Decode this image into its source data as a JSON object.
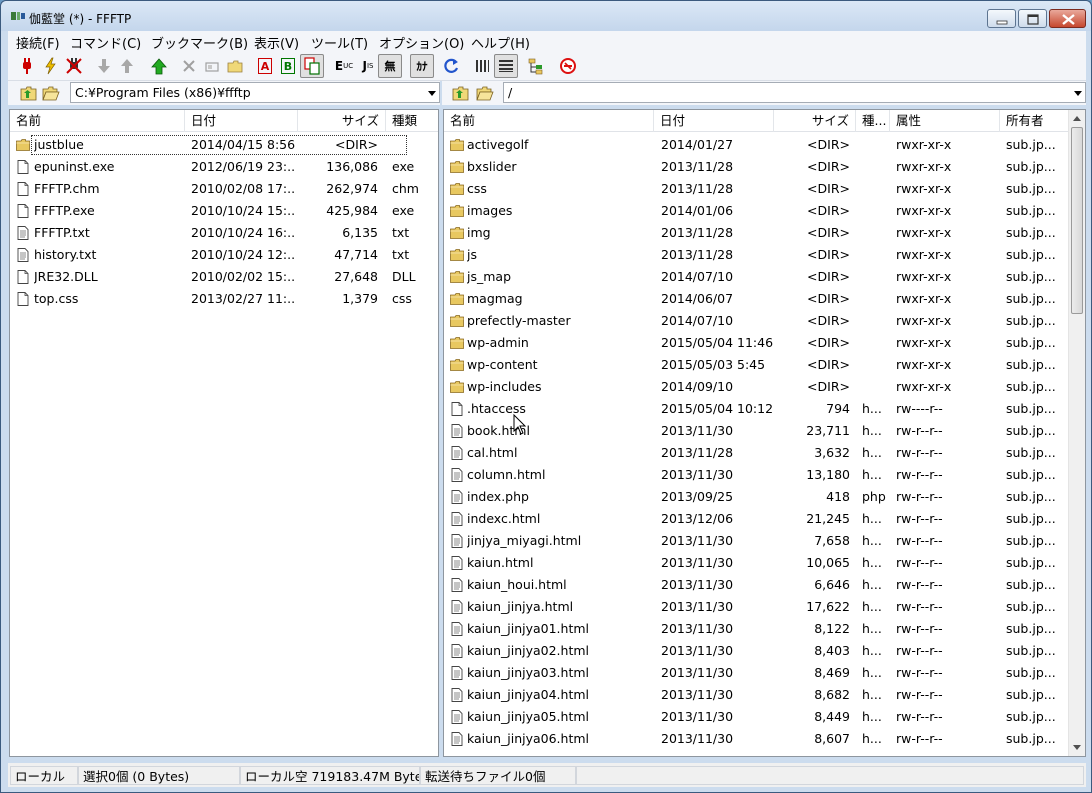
{
  "window": {
    "title": "伽藍堂 (*) - FFFTP"
  },
  "menu": [
    "接続(F)",
    "コマンド(C)",
    "ブックマーク(B)",
    "表示(V)",
    "ツール(T)",
    "オプション(O)",
    "ヘルプ(H)"
  ],
  "toolbar": {
    "ascii_mode": "A",
    "binary_mode": "B",
    "euc_label": "E",
    "jis_label": "J",
    "no_convert_label": "無",
    "kana_label": "ｶﾅ"
  },
  "local": {
    "path": "C:¥Program Files (x86)¥ffftp",
    "columns": {
      "name": "名前",
      "date": "日付",
      "size": "サイズ",
      "type": "種類"
    },
    "files": [
      {
        "name": "justblue",
        "date": "2014/04/15  8:56",
        "size": "<DIR>",
        "type": "",
        "icon": "folder-icon"
      },
      {
        "name": "epuninst.exe",
        "date": "2012/06/19 23:...",
        "size": "136,086",
        "type": "exe",
        "icon": "file-icon"
      },
      {
        "name": "FFFTP.chm",
        "date": "2010/02/08 17:...",
        "size": "262,974",
        "type": "chm",
        "icon": "file-icon"
      },
      {
        "name": "FFFTP.exe",
        "date": "2010/10/24 15:...",
        "size": "425,984",
        "type": "exe",
        "icon": "file-icon"
      },
      {
        "name": "FFFTP.txt",
        "date": "2010/10/24 16:...",
        "size": "6,135",
        "type": "txt",
        "icon": "text-file-icon"
      },
      {
        "name": "history.txt",
        "date": "2010/10/24 12:...",
        "size": "47,714",
        "type": "txt",
        "icon": "text-file-icon"
      },
      {
        "name": "JRE32.DLL",
        "date": "2010/02/02 15:...",
        "size": "27,648",
        "type": "DLL",
        "icon": "file-icon"
      },
      {
        "name": "top.css",
        "date": "2013/02/27 11:...",
        "size": "1,379",
        "type": "css",
        "icon": "file-icon"
      }
    ]
  },
  "remote": {
    "path": "/",
    "columns": {
      "name": "名前",
      "date": "日付",
      "size": "サイズ",
      "type": "種...",
      "attr": "属性",
      "owner": "所有者"
    },
    "files": [
      {
        "name": "activegolf",
        "date": "2014/01/27",
        "size": "<DIR>",
        "type": "",
        "attr": "rwxr-xr-x",
        "owner": "sub.jp...",
        "icon": "folder-icon"
      },
      {
        "name": "bxslider",
        "date": "2013/11/28",
        "size": "<DIR>",
        "type": "",
        "attr": "rwxr-xr-x",
        "owner": "sub.jp...",
        "icon": "folder-icon"
      },
      {
        "name": "css",
        "date": "2013/11/28",
        "size": "<DIR>",
        "type": "",
        "attr": "rwxr-xr-x",
        "owner": "sub.jp...",
        "icon": "folder-icon"
      },
      {
        "name": "images",
        "date": "2014/01/06",
        "size": "<DIR>",
        "type": "",
        "attr": "rwxr-xr-x",
        "owner": "sub.jp...",
        "icon": "folder-icon"
      },
      {
        "name": "img",
        "date": "2013/11/28",
        "size": "<DIR>",
        "type": "",
        "attr": "rwxr-xr-x",
        "owner": "sub.jp...",
        "icon": "folder-icon"
      },
      {
        "name": "js",
        "date": "2013/11/28",
        "size": "<DIR>",
        "type": "",
        "attr": "rwxr-xr-x",
        "owner": "sub.jp...",
        "icon": "folder-icon"
      },
      {
        "name": "js_map",
        "date": "2014/07/10",
        "size": "<DIR>",
        "type": "",
        "attr": "rwxr-xr-x",
        "owner": "sub.jp...",
        "icon": "folder-icon"
      },
      {
        "name": "magmag",
        "date": "2014/06/07",
        "size": "<DIR>",
        "type": "",
        "attr": "rwxr-xr-x",
        "owner": "sub.jp...",
        "icon": "folder-icon"
      },
      {
        "name": "prefectly-master",
        "date": "2014/07/10",
        "size": "<DIR>",
        "type": "",
        "attr": "rwxr-xr-x",
        "owner": "sub.jp...",
        "icon": "folder-icon"
      },
      {
        "name": "wp-admin",
        "date": "2015/05/04 11:46",
        "size": "<DIR>",
        "type": "",
        "attr": "rwxr-xr-x",
        "owner": "sub.jp...",
        "icon": "folder-icon"
      },
      {
        "name": "wp-content",
        "date": "2015/05/03  5:45",
        "size": "<DIR>",
        "type": "",
        "attr": "rwxr-xr-x",
        "owner": "sub.jp...",
        "icon": "folder-icon"
      },
      {
        "name": "wp-includes",
        "date": "2014/09/10",
        "size": "<DIR>",
        "type": "",
        "attr": "rwxr-xr-x",
        "owner": "sub.jp...",
        "icon": "folder-icon"
      },
      {
        "name": ".htaccess",
        "date": "2015/05/04 10:12",
        "size": "794",
        "type": "h...",
        "attr": "rw----r--",
        "owner": "sub.jp...",
        "icon": "file-icon"
      },
      {
        "name": "book.html",
        "date": "2013/11/30",
        "size": "23,711",
        "type": "h...",
        "attr": "rw-r--r--",
        "owner": "sub.jp...",
        "icon": "text-file-icon"
      },
      {
        "name": "cal.html",
        "date": "2013/11/28",
        "size": "3,632",
        "type": "h...",
        "attr": "rw-r--r--",
        "owner": "sub.jp...",
        "icon": "text-file-icon"
      },
      {
        "name": "column.html",
        "date": "2013/11/30",
        "size": "13,180",
        "type": "h...",
        "attr": "rw-r--r--",
        "owner": "sub.jp...",
        "icon": "text-file-icon"
      },
      {
        "name": "index.php",
        "date": "2013/09/25",
        "size": "418",
        "type": "php",
        "attr": "rw-r--r--",
        "owner": "sub.jp...",
        "icon": "text-file-icon"
      },
      {
        "name": "indexc.html",
        "date": "2013/12/06",
        "size": "21,245",
        "type": "h...",
        "attr": "rw-r--r--",
        "owner": "sub.jp...",
        "icon": "text-file-icon"
      },
      {
        "name": "jinjya_miyagi.html",
        "date": "2013/11/30",
        "size": "7,658",
        "type": "h...",
        "attr": "rw-r--r--",
        "owner": "sub.jp...",
        "icon": "text-file-icon"
      },
      {
        "name": "kaiun.html",
        "date": "2013/11/30",
        "size": "10,065",
        "type": "h...",
        "attr": "rw-r--r--",
        "owner": "sub.jp...",
        "icon": "text-file-icon"
      },
      {
        "name": "kaiun_houi.html",
        "date": "2013/11/30",
        "size": "6,646",
        "type": "h...",
        "attr": "rw-r--r--",
        "owner": "sub.jp...",
        "icon": "text-file-icon"
      },
      {
        "name": "kaiun_jinjya.html",
        "date": "2013/11/30",
        "size": "17,622",
        "type": "h...",
        "attr": "rw-r--r--",
        "owner": "sub.jp...",
        "icon": "text-file-icon"
      },
      {
        "name": "kaiun_jinjya01.html",
        "date": "2013/11/30",
        "size": "8,122",
        "type": "h...",
        "attr": "rw-r--r--",
        "owner": "sub.jp...",
        "icon": "text-file-icon"
      },
      {
        "name": "kaiun_jinjya02.html",
        "date": "2013/11/30",
        "size": "8,403",
        "type": "h...",
        "attr": "rw-r--r--",
        "owner": "sub.jp...",
        "icon": "text-file-icon"
      },
      {
        "name": "kaiun_jinjya03.html",
        "date": "2013/11/30",
        "size": "8,469",
        "type": "h...",
        "attr": "rw-r--r--",
        "owner": "sub.jp...",
        "icon": "text-file-icon"
      },
      {
        "name": "kaiun_jinjya04.html",
        "date": "2013/11/30",
        "size": "8,682",
        "type": "h...",
        "attr": "rw-r--r--",
        "owner": "sub.jp...",
        "icon": "text-file-icon"
      },
      {
        "name": "kaiun_jinjya05.html",
        "date": "2013/11/30",
        "size": "8,449",
        "type": "h...",
        "attr": "rw-r--r--",
        "owner": "sub.jp...",
        "icon": "text-file-icon"
      },
      {
        "name": "kaiun_jinjya06.html",
        "date": "2013/11/30",
        "size": "8,607",
        "type": "h...",
        "attr": "rw-r--r--",
        "owner": "sub.jp...",
        "icon": "text-file-icon"
      }
    ]
  },
  "status": {
    "mode": "ローカル",
    "selection": "選択0個 (0 Bytes)",
    "local_free": "ローカル空 719183.47M Bytes",
    "queue": "転送待ちファイル0個"
  },
  "colors": {
    "folder": "#e8c860",
    "accent_red": "#cc0000",
    "accent_green": "#2a9a2a",
    "upload_green": "#22aa22",
    "refresh_blue": "#2255cc"
  }
}
